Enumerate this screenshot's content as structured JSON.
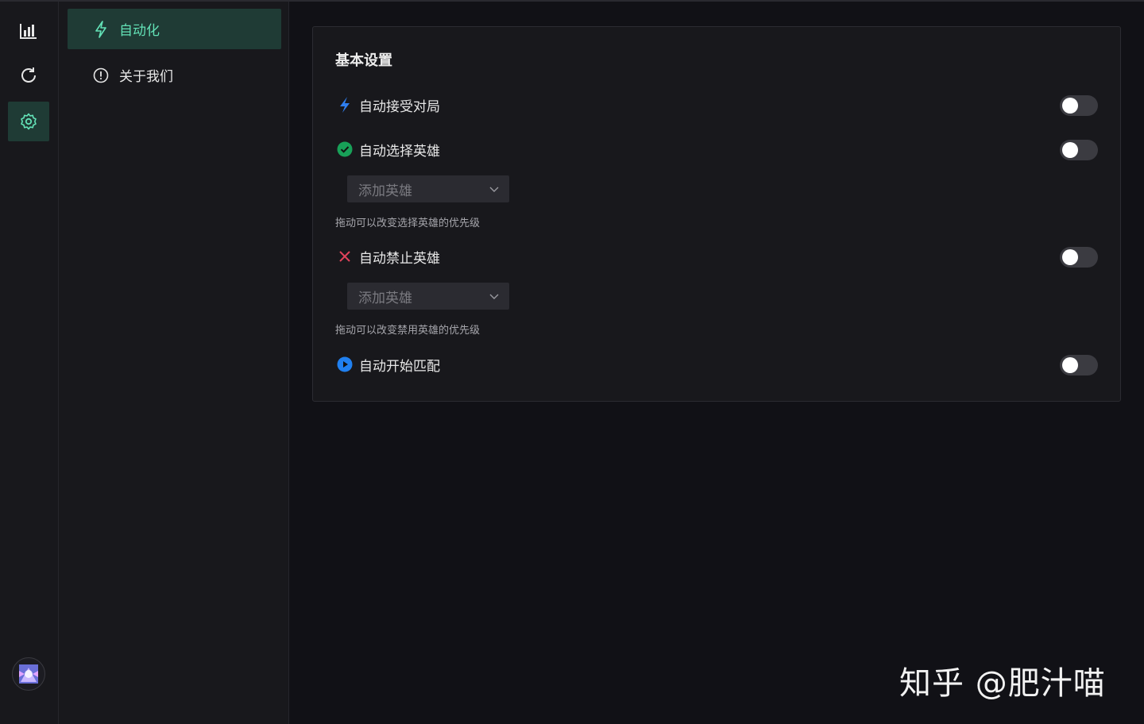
{
  "rail": {
    "items": [
      {
        "name": "stats",
        "icon": "bar-chart-icon"
      },
      {
        "name": "refresh",
        "icon": "refresh-icon"
      },
      {
        "name": "settings",
        "icon": "gear-icon",
        "active": true
      }
    ],
    "avatar_icon": "avatar-icon"
  },
  "submenu": {
    "items": [
      {
        "label": "自动化",
        "icon": "lightning-icon",
        "active": true
      },
      {
        "label": "关于我们",
        "icon": "info-circle-icon"
      }
    ]
  },
  "settings": {
    "title": "基本设置",
    "auto_accept": {
      "label": "自动接受对局",
      "enabled": false
    },
    "auto_pick": {
      "label": "自动选择英雄",
      "enabled": false,
      "select_placeholder": "添加英雄",
      "hint": "拖动可以改变选择英雄的优先级"
    },
    "auto_ban": {
      "label": "自动禁止英雄",
      "enabled": false,
      "select_placeholder": "添加英雄",
      "hint": "拖动可以改变禁用英雄的优先级"
    },
    "auto_match": {
      "label": "自动开始匹配",
      "enabled": false
    }
  },
  "watermark": "知乎 @肥汁喵",
  "colors": {
    "accent": "#63e2b7",
    "active_bg": "#1f3b35",
    "lightning_blue": "#2f7ff0",
    "check_green": "#18a058",
    "cross_red": "#e0435a",
    "play_blue": "#2080f0"
  }
}
